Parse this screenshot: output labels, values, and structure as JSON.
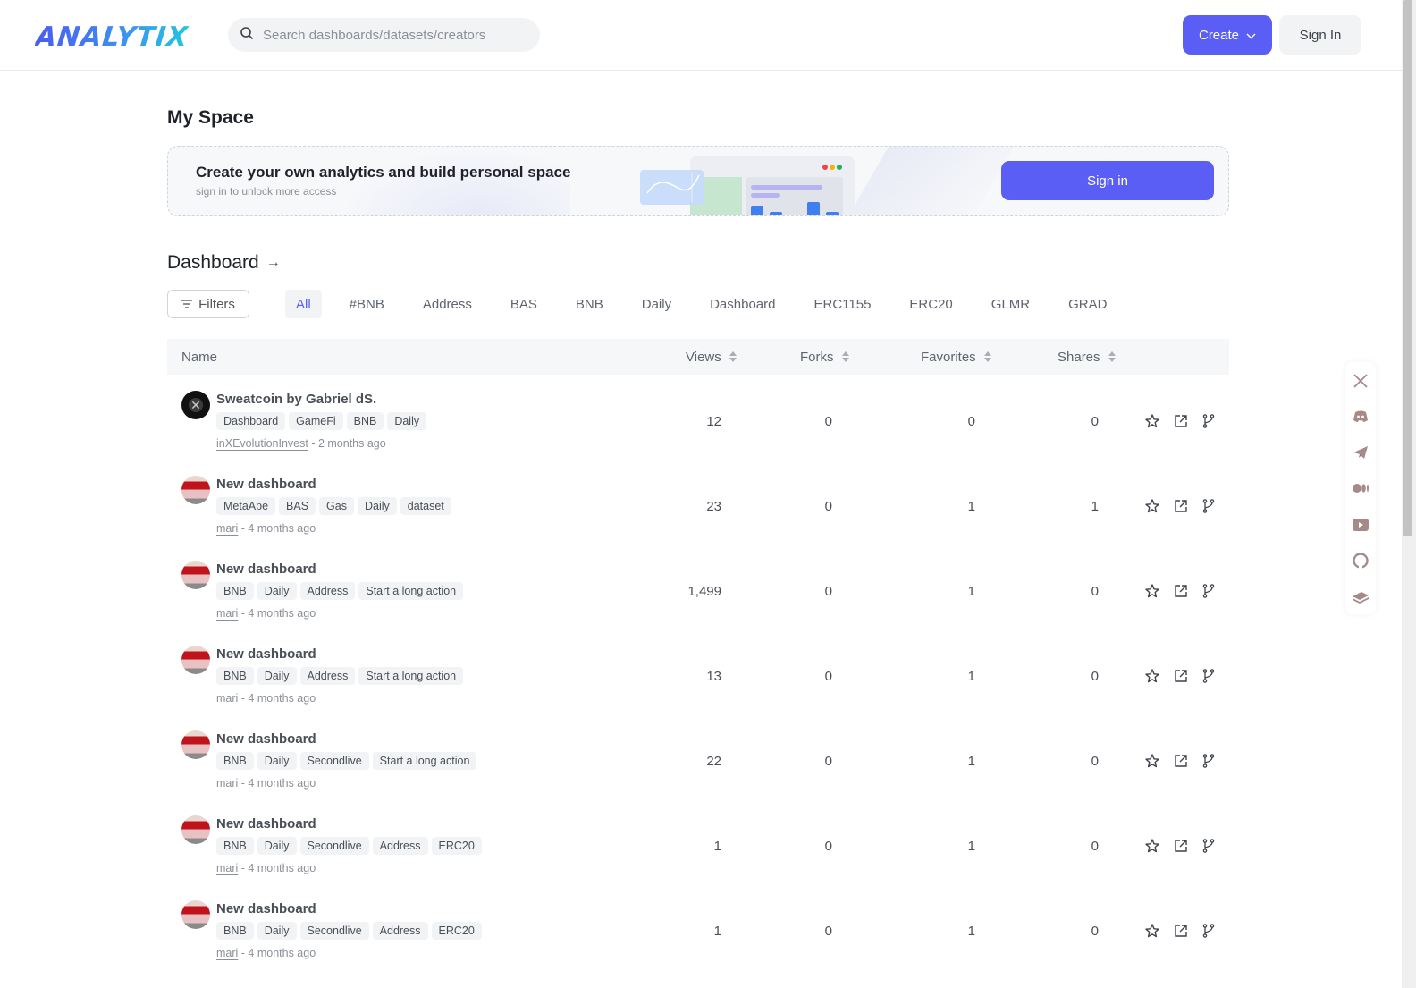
{
  "header": {
    "logo": "ANALYTIX",
    "search_placeholder": "Search dashboards/datasets/creators",
    "create_label": "Create",
    "signin_label": "Sign In"
  },
  "my_space": {
    "title": "My Space",
    "banner_title": "Create your own analytics and build personal space",
    "banner_subtitle": "sign in to unlock more access",
    "banner_signin_label": "Sign in"
  },
  "dashboard": {
    "title": "Dashboard",
    "arrow": "→",
    "filters_label": "Filters",
    "tags": [
      "All",
      "#BNB",
      "Address",
      "BAS",
      "BNB",
      "Daily",
      "Dashboard",
      "ERC1155",
      "ERC20",
      "GLMR",
      "GRAD"
    ],
    "active_tag": "All",
    "columns": {
      "name": "Name",
      "views": "Views",
      "forks": "Forks",
      "favorites": "Favorites",
      "shares": "Shares"
    },
    "rows": [
      {
        "title": "Sweatcoin by Gabriel dS.",
        "tags": [
          "Dashboard",
          "GameFi",
          "BNB",
          "Daily"
        ],
        "author": "inXEvolutionInvest",
        "time": " - 2 months ago",
        "views": "12",
        "forks": "0",
        "favorites": "0",
        "shares": "0",
        "avatar": "dark"
      },
      {
        "title": "New dashboard",
        "tags": [
          "MetaApe",
          "BAS",
          "Gas",
          "Daily",
          "dataset"
        ],
        "author": "mari",
        "time": " - 4 months ago",
        "views": "23",
        "forks": "0",
        "favorites": "1",
        "shares": "1",
        "avatar": "red"
      },
      {
        "title": "New dashboard",
        "tags": [
          "BNB",
          "Daily",
          "Address",
          "Start a long action"
        ],
        "author": "mari",
        "time": " - 4 months ago",
        "views": "1,499",
        "forks": "0",
        "favorites": "1",
        "shares": "0",
        "avatar": "red"
      },
      {
        "title": "New dashboard",
        "tags": [
          "BNB",
          "Daily",
          "Address",
          "Start a long action"
        ],
        "author": "mari",
        "time": " - 4 months ago",
        "views": "13",
        "forks": "0",
        "favorites": "1",
        "shares": "0",
        "avatar": "red"
      },
      {
        "title": "New dashboard",
        "tags": [
          "BNB",
          "Daily",
          "Secondlive",
          "Start a long action"
        ],
        "author": "mari",
        "time": " - 4 months ago",
        "views": "22",
        "forks": "0",
        "favorites": "1",
        "shares": "0",
        "avatar": "red"
      },
      {
        "title": "New dashboard",
        "tags": [
          "BNB",
          "Daily",
          "Secondlive",
          "Address",
          "ERC20"
        ],
        "author": "mari",
        "time": " - 4 months ago",
        "views": "1",
        "forks": "0",
        "favorites": "1",
        "shares": "0",
        "avatar": "red"
      },
      {
        "title": "New dashboard",
        "tags": [
          "BNB",
          "Daily",
          "Secondlive",
          "Address",
          "ERC20"
        ],
        "author": "mari",
        "time": " - 4 months ago",
        "views": "1",
        "forks": "0",
        "favorites": "1",
        "shares": "0",
        "avatar": "red"
      }
    ],
    "row_actions": [
      "star-icon",
      "open-external-icon",
      "fork-icon"
    ]
  },
  "social_links": [
    "x-icon",
    "discord-icon",
    "telegram-icon",
    "medium-icon",
    "youtube-icon",
    "github-icon",
    "docs-icon"
  ],
  "colors": {
    "accent": "#5b5ef4",
    "social_icon": "#a68a8a"
  }
}
